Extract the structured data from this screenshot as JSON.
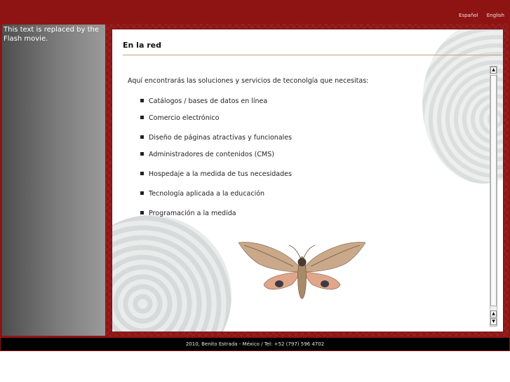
{
  "header": {
    "languages": [
      {
        "label": "Español"
      },
      {
        "label": "English"
      }
    ]
  },
  "flash": {
    "placeholder": "This text is replaced by the Flash movie."
  },
  "main": {
    "title": "En la red",
    "intro": "Aquí encontrarás las soluciones y servicios de teconolgía que necesitas:",
    "services": [
      {
        "label": "Catálogos / bases de datos en línea"
      },
      {
        "label": "Comercio electrónico"
      },
      {
        "label": "Diseño de páginas atractivas y funcionales"
      },
      {
        "label": "Administradores de contenidos (CMS)"
      },
      {
        "label": "Hospedaje a la medida de tus necesidades"
      },
      {
        "label": "Tecnología aplicada a la educación"
      },
      {
        "label": "Programación a la medida"
      }
    ],
    "image": {
      "icon": "moth-image"
    }
  },
  "scrollbar": {
    "up_icon": "▲",
    "down_icon": "▼"
  },
  "footer": {
    "text": "2010, Benito Estrada - México / Tel: +52 (797) 596 4702"
  },
  "colors": {
    "brand_red": "#8e1414",
    "footer_bg": "#000000",
    "rule": "#c8a070"
  }
}
